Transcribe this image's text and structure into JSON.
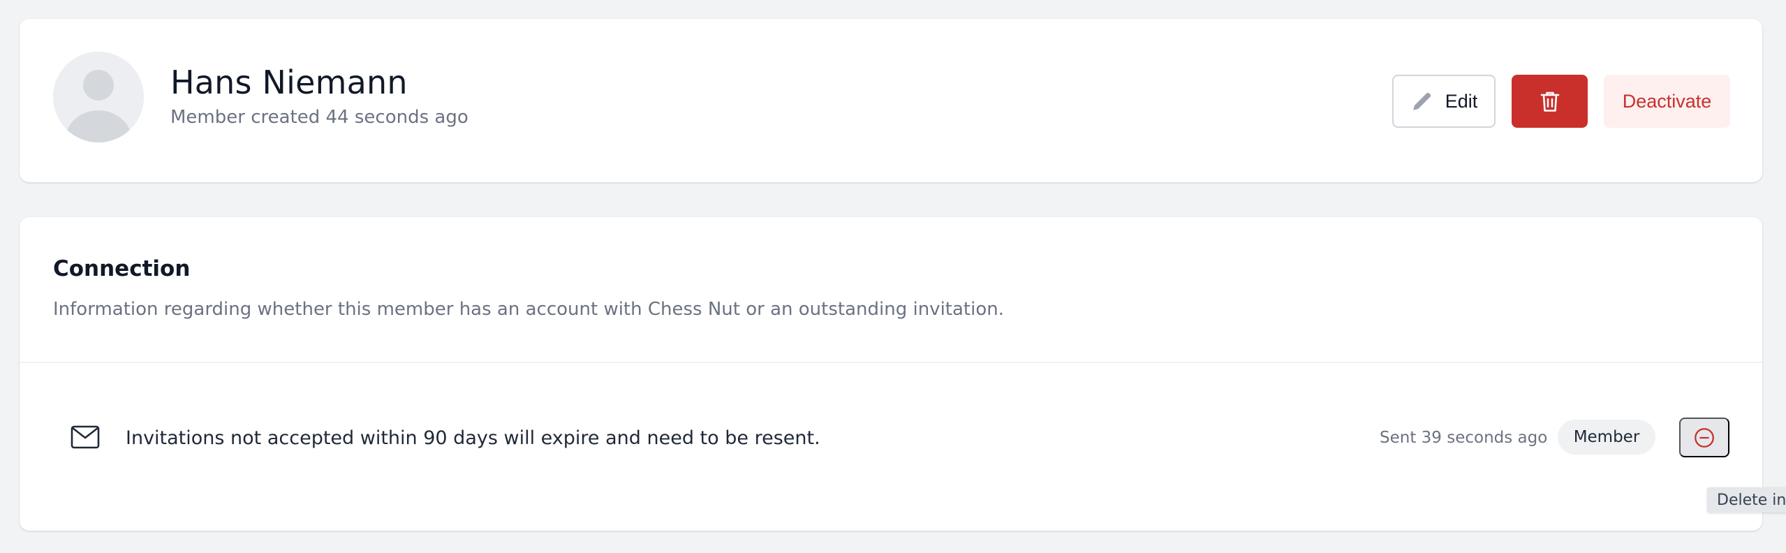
{
  "profile": {
    "name": "Hans Niemann",
    "created": "Member created 44 seconds ago",
    "avatar_icon": "user-placeholder-icon",
    "actions": {
      "edit_label": "Edit",
      "edit_icon": "pencil-icon",
      "delete_icon": "trash-icon",
      "deactivate_label": "Deactivate"
    }
  },
  "connection": {
    "title": "Connection",
    "description": "Information regarding whether this member has an account with Chess Nut or an outstanding invitation.",
    "invitation": {
      "icon": "envelope-icon",
      "message": "Invitations not accepted within 90 days will expire and need to be resent.",
      "sent": "Sent 39 seconds ago",
      "role": "Member",
      "remove_icon": "minus-circle-icon"
    }
  },
  "tooltip": {
    "text": "Delete inv"
  },
  "colors": {
    "background": "#f2f3f5",
    "danger": "#c9302c",
    "danger_soft": "#fdf0ef",
    "muted_text": "#6b7280",
    "badge_bg": "#f0f1f3"
  }
}
